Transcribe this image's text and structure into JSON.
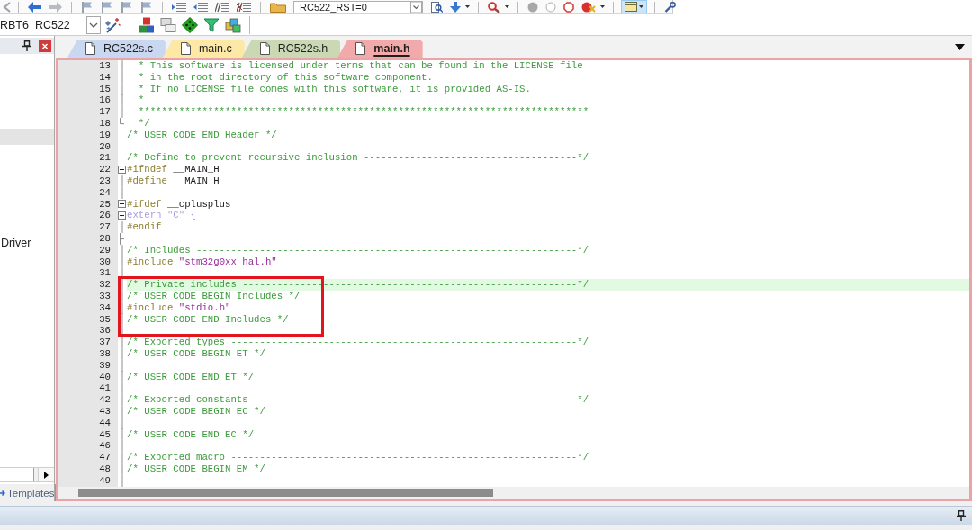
{
  "toolbar": {
    "symbol_combo": {
      "value": "RC522_RST=0"
    }
  },
  "build_toolbar": {
    "target_combo": {
      "value": "RBT6_RC522"
    }
  },
  "project_panel": {
    "items": [
      {
        "selected": true
      },
      {
        "label": "Driver",
        "selected": false
      }
    ],
    "tabs": [
      {
        "label": "Templates",
        "selected": false
      }
    ]
  },
  "editor": {
    "tabs": [
      {
        "label": "RC522s.c",
        "color": "#c9d8f0",
        "selected": false
      },
      {
        "label": "main.c",
        "color": "#fde8a6",
        "selected": false
      },
      {
        "label": "RC522s.h",
        "color": "#cad9b4",
        "selected": false
      },
      {
        "label": "main.h",
        "color": "#f1a9aa",
        "selected": true
      }
    ],
    "lines": [
      {
        "number": "13",
        "fold": {
          "kind": "line"
        },
        "highlighted": false,
        "tokens": [
          {
            "kind": "comment",
            "text": "  * This software is licensed under terms that can be found in the LICENSE file"
          }
        ]
      },
      {
        "number": "14",
        "fold": {
          "kind": "line"
        },
        "highlighted": false,
        "tokens": [
          {
            "kind": "comment",
            "text": "  * in the root directory of this software component."
          }
        ]
      },
      {
        "number": "15",
        "fold": {
          "kind": "line"
        },
        "highlighted": false,
        "tokens": [
          {
            "kind": "comment",
            "text": "  * If no LICENSE file comes with this software, it is provided AS-IS."
          }
        ]
      },
      {
        "number": "16",
        "fold": {
          "kind": "line"
        },
        "highlighted": false,
        "tokens": [
          {
            "kind": "comment",
            "text": "  *"
          }
        ]
      },
      {
        "number": "17",
        "fold": {
          "kind": "line"
        },
        "highlighted": false,
        "tokens": [
          {
            "kind": "comment",
            "text": "  ******************************************************************************"
          }
        ]
      },
      {
        "number": "18",
        "fold": {
          "kind": "end"
        },
        "highlighted": false,
        "tokens": [
          {
            "kind": "comment",
            "text": "  */"
          }
        ]
      },
      {
        "number": "19",
        "highlighted": false,
        "tokens": [
          {
            "kind": "comment",
            "text": "/* USER CODE END Header */"
          }
        ]
      },
      {
        "number": "20",
        "highlighted": false
      },
      {
        "number": "21",
        "highlighted": false,
        "tokens": [
          {
            "kind": "comment",
            "text": "/* Define to prevent recursive inclusion -------------------------------------*/"
          }
        ]
      },
      {
        "number": "22",
        "fold": {
          "kind": "box"
        },
        "highlighted": false,
        "tokens": [
          {
            "kind": "directive",
            "text": "#ifndef"
          },
          {
            "kind": "text",
            "text": " __MAIN_H"
          }
        ]
      },
      {
        "number": "23",
        "fold": {
          "kind": "line"
        },
        "highlighted": false,
        "tokens": [
          {
            "kind": "directive",
            "text": "#define"
          },
          {
            "kind": "text",
            "text": " __MAIN_H"
          }
        ]
      },
      {
        "number": "24",
        "fold": {
          "kind": "line"
        },
        "highlighted": false
      },
      {
        "number": "25",
        "fold": {
          "kind": "box"
        },
        "highlighted": false,
        "tokens": [
          {
            "kind": "directive",
            "text": "#ifdef"
          },
          {
            "kind": "text",
            "text": " __cplusplus"
          }
        ]
      },
      {
        "number": "26",
        "fold": {
          "kind": "box"
        },
        "highlighted": false,
        "tokens": [
          {
            "kind": "inactive",
            "text": "extern \"C\" {"
          }
        ]
      },
      {
        "number": "27",
        "fold": {
          "kind": "line"
        },
        "highlighted": false,
        "tokens": [
          {
            "kind": "directive",
            "text": "#endif"
          }
        ]
      },
      {
        "number": "28",
        "fold": {
          "kind": "tee"
        },
        "highlighted": false
      },
      {
        "number": "29",
        "fold": {
          "kind": "line"
        },
        "highlighted": false,
        "tokens": [
          {
            "kind": "comment",
            "text": "/* Includes ------------------------------------------------------------------*/"
          }
        ]
      },
      {
        "number": "30",
        "fold": {
          "kind": "line"
        },
        "highlighted": false,
        "tokens": [
          {
            "kind": "directive",
            "text": "#include "
          },
          {
            "kind": "string",
            "text": "\"stm32g0xx_hal.h\""
          }
        ]
      },
      {
        "number": "31",
        "fold": {
          "kind": "line"
        },
        "highlighted": false
      },
      {
        "number": "32",
        "fold": {
          "kind": "line"
        },
        "highlighted": true,
        "tokens": [
          {
            "kind": "comment",
            "text": "/* Private includes ----------------------------------------------------------*/"
          }
        ]
      },
      {
        "number": "33",
        "fold": {
          "kind": "line"
        },
        "highlighted": false,
        "tokens": [
          {
            "kind": "comment",
            "text": "/* USER CODE BEGIN Includes */"
          }
        ]
      },
      {
        "number": "34",
        "fold": {
          "kind": "line"
        },
        "highlighted": false,
        "tokens": [
          {
            "kind": "directive",
            "text": "#include "
          },
          {
            "kind": "string",
            "text": "\"stdio.h\""
          }
        ]
      },
      {
        "number": "35",
        "fold": {
          "kind": "line"
        },
        "highlighted": false,
        "tokens": [
          {
            "kind": "comment",
            "text": "/* USER CODE END Includes */"
          }
        ]
      },
      {
        "number": "36",
        "fold": {
          "kind": "line"
        },
        "highlighted": false
      },
      {
        "number": "37",
        "fold": {
          "kind": "line"
        },
        "highlighted": false,
        "tokens": [
          {
            "kind": "comment",
            "text": "/* Exported types ------------------------------------------------------------*/"
          }
        ]
      },
      {
        "number": "38",
        "fold": {
          "kind": "line"
        },
        "highlighted": false,
        "tokens": [
          {
            "kind": "comment",
            "text": "/* USER CODE BEGIN ET */"
          }
        ]
      },
      {
        "number": "39",
        "fold": {
          "kind": "line"
        },
        "highlighted": false
      },
      {
        "number": "40",
        "fold": {
          "kind": "line"
        },
        "highlighted": false,
        "tokens": [
          {
            "kind": "comment",
            "text": "/* USER CODE END ET */"
          }
        ]
      },
      {
        "number": "41",
        "fold": {
          "kind": "line"
        },
        "highlighted": false
      },
      {
        "number": "42",
        "fold": {
          "kind": "line"
        },
        "highlighted": false,
        "tokens": [
          {
            "kind": "comment",
            "text": "/* Exported constants --------------------------------------------------------*/"
          }
        ]
      },
      {
        "number": "43",
        "fold": {
          "kind": "line"
        },
        "highlighted": false,
        "tokens": [
          {
            "kind": "comment",
            "text": "/* USER CODE BEGIN EC */"
          }
        ]
      },
      {
        "number": "44",
        "fold": {
          "kind": "line"
        },
        "highlighted": false
      },
      {
        "number": "45",
        "fold": {
          "kind": "line"
        },
        "highlighted": false,
        "tokens": [
          {
            "kind": "comment",
            "text": "/* USER CODE END EC */"
          }
        ]
      },
      {
        "number": "46",
        "fold": {
          "kind": "line"
        },
        "highlighted": false
      },
      {
        "number": "47",
        "fold": {
          "kind": "line"
        },
        "highlighted": false,
        "tokens": [
          {
            "kind": "comment",
            "text": "/* Exported macro ------------------------------------------------------------*/"
          }
        ]
      },
      {
        "number": "48",
        "fold": {
          "kind": "line"
        },
        "highlighted": false,
        "tokens": [
          {
            "kind": "comment",
            "text": "/* USER CODE BEGIN EM */"
          }
        ]
      },
      {
        "number": "49",
        "fold": {
          "kind": "line"
        },
        "highlighted": false
      }
    ]
  }
}
